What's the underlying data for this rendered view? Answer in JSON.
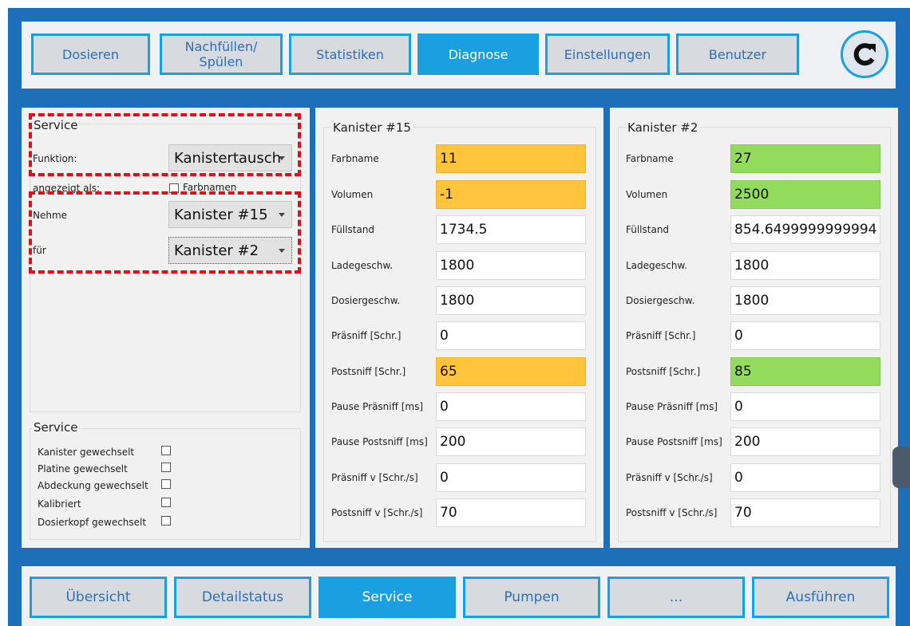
{
  "topnav": {
    "items": [
      {
        "label": "Dosieren",
        "active": false
      },
      {
        "label": "Nachfüllen/\nSpülen",
        "active": false
      },
      {
        "label": "Statistiken",
        "active": false
      },
      {
        "label": "Diagnose",
        "active": true
      },
      {
        "label": "Einstellungen",
        "active": false
      },
      {
        "label": "Benutzer",
        "active": false
      }
    ],
    "refresh_icon": "refresh-icon"
  },
  "service_panel": {
    "title": "Service",
    "funktion_label": "Funktion:",
    "funktion_value": "Kanistertausch",
    "angezeigt_label": "angezeigt als:",
    "farbnamen_label": "Farbnamen",
    "nehme_label": "Nehme",
    "nehme_value": "Kanister #15",
    "fuer_label": "für",
    "fuer_value": "Kanister #2"
  },
  "service_checks": {
    "title": "Service",
    "items": [
      {
        "label": "Kanister gewechselt",
        "checked": false
      },
      {
        "label": "Platine gewechselt",
        "checked": false
      },
      {
        "label": "Abdeckung gewechselt",
        "checked": false
      },
      {
        "label": "Kalibriert",
        "checked": false
      },
      {
        "label": "Dosierkopf gewechselt",
        "checked": false
      }
    ]
  },
  "field_labels": [
    "Farbname",
    "Volumen",
    "Füllstand",
    "Ladegeschw.",
    "Dosiergeschw.",
    "Präsniff [Schr.]",
    "Postsniff [Schr.]",
    "Pause Präsniff [ms]",
    "Pause Postsniff [ms]",
    "Präsniff v [Schr./s]",
    "Postsniff v [Schr./s]"
  ],
  "kanister_a": {
    "title": "Kanister #15",
    "values": [
      "11",
      "-1",
      "1734.5",
      "1800",
      "1800",
      "0",
      "65",
      "0",
      "200",
      "0",
      "70"
    ],
    "highlight_color": "#ffc43b"
  },
  "kanister_b": {
    "title": "Kanister #2",
    "values": [
      "27",
      "2500",
      "854.6499999999994",
      "1800",
      "1800",
      "0",
      "85",
      "0",
      "200",
      "0",
      "70"
    ],
    "highlight_color": "#93db5c"
  },
  "bottomnav": {
    "items": [
      {
        "label": "Übersicht",
        "active": false
      },
      {
        "label": "Detailstatus",
        "active": false
      },
      {
        "label": "Service",
        "active": true
      },
      {
        "label": "Pumpen",
        "active": false
      },
      {
        "label": "...",
        "active": false
      },
      {
        "label": "Ausführen",
        "active": false
      }
    ]
  },
  "colors": {
    "frame_blue": "#1c6fb8",
    "accent": "#1aa0e0",
    "highlight_red": "#e0101a"
  }
}
